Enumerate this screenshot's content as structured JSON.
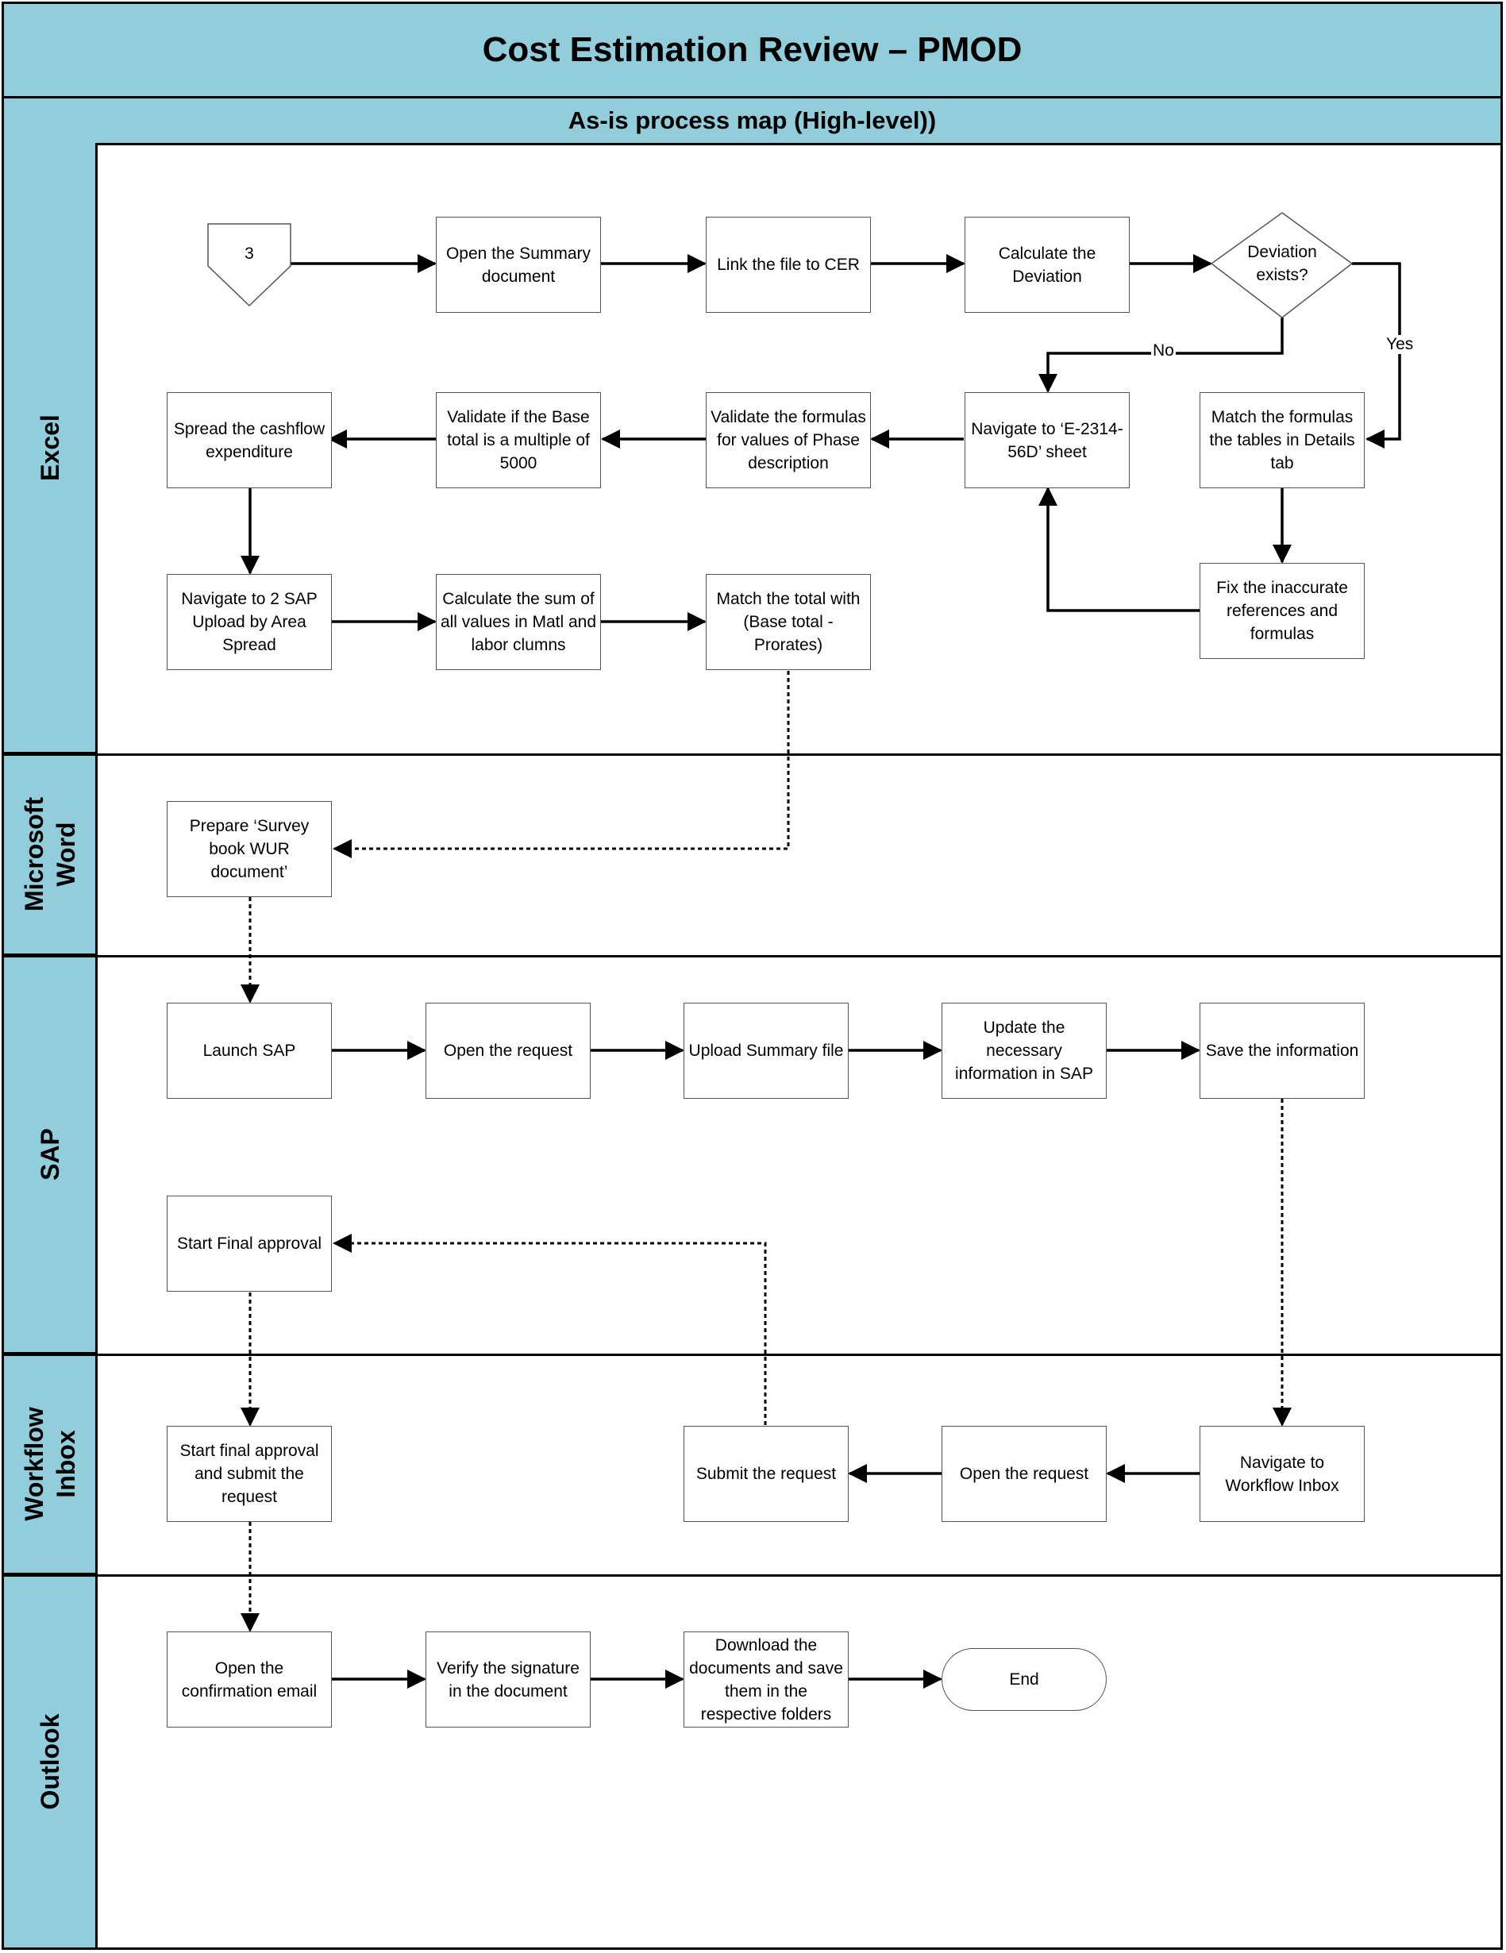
{
  "header": {
    "title": "Cost Estimation Review – PMOD",
    "subtitle": "As-is process map (High-level))"
  },
  "colors": {
    "lane_fill": "#92CDDC",
    "line": "#000000",
    "box_border": "#555555"
  },
  "lanes": [
    {
      "id": "excel",
      "label": "Excel"
    },
    {
      "id": "word",
      "label": "Microsoft\nWord"
    },
    {
      "id": "sap",
      "label": "SAP"
    },
    {
      "id": "workflow",
      "label": "Workflow\nInbox"
    },
    {
      "id": "outlook",
      "label": "Outlook"
    }
  ],
  "connector": {
    "label": "3",
    "icon": "off-page-connector-icon"
  },
  "steps": {
    "open_summary": "Open the Summary document",
    "link_file": "Link the file to CER",
    "calc_deviation": "Calculate the Deviation",
    "deviation_exists": "Deviation exists?",
    "match_formulas": "Match the formulas the tables in Details tab",
    "fix_refs": "Fix the inaccurate references and formulas",
    "navigate_sheet": "Navigate to ‘E-2314-56D’ sheet",
    "validate_formulas": "Validate the formulas for values of Phase description",
    "validate_base": "Validate if the Base total is a multiple of 5000",
    "spread_cashflow": "Spread the cashflow expenditure",
    "navigate_sap_upload": "Navigate to 2 SAP Upload by Area Spread",
    "calc_sum": "Calculate the sum of all values in Matl and labor clumns",
    "match_total": "Match the total with (Base total - Prorates)",
    "prepare_survey": "Prepare ‘Survey book WUR document’",
    "launch_sap": "Launch SAP",
    "open_request_sap": "Open the request",
    "upload_summary": "Upload Summary file",
    "update_info": "Update the necessary information in SAP",
    "save_info": "Save the information",
    "start_final_approval": "Start Final approval",
    "navigate_workflow": "Navigate to Workflow Inbox",
    "open_request_wf": "Open the request",
    "submit_request": "Submit the request",
    "start_final_submit": "Start final approval and submit the request",
    "open_email": "Open the confirmation email",
    "verify_signature": "Verify the signature in the document",
    "download_docs": "Download the documents and save them in the respective folders",
    "end": "End"
  },
  "edge_labels": {
    "no": "No",
    "yes": "Yes"
  }
}
